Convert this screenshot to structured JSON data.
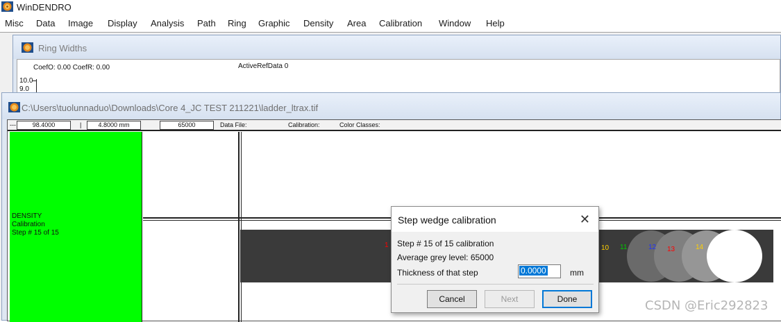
{
  "app": {
    "title": "WinDENDRO",
    "icon": "windendro-icon"
  },
  "menu": [
    "Misc",
    "Data",
    "Image",
    "Display",
    "Analysis",
    "Path",
    "Ring",
    "Graphic",
    "Density",
    "Area",
    "Calibration",
    "Window",
    "Help"
  ],
  "ring_window": {
    "title": "Ring Widths",
    "coef": "CoefO: 0.00  CoefR: 0.00",
    "active_ref": "ActiveRefData  0",
    "y_ticks": [
      "10.0",
      "9.0"
    ]
  },
  "image_window": {
    "title": "C:\\Users\\tuolunnaduo\\Downloads\\Core 4_JC TEST 211221\\ladder_ltrax.tif",
    "status": {
      "dash": "---",
      "x_value": "98.4000",
      "bar": "|",
      "y_value": "4.8000 mm",
      "grey_value": "65000",
      "data_file": "Data File:",
      "calibration": "Calibration:",
      "color_classes": "Color Classes:"
    },
    "panel": {
      "line1": "DENSITY",
      "line2": "Calibration",
      "line3": "Step # 15 of 15"
    },
    "step_labels": [
      {
        "text": "1",
        "color": "#ff0000"
      },
      {
        "text": "10",
        "color": "#ffd000"
      },
      {
        "text": "11",
        "color": "#00c800"
      },
      {
        "text": "12",
        "color": "#1e32ff"
      },
      {
        "text": "13",
        "color": "#ff0000"
      },
      {
        "text": "14",
        "color": "#ffd000"
      }
    ]
  },
  "dialog": {
    "title": "Step wedge calibration",
    "line1": "Step # 15 of 15 calibration",
    "line2": "Average grey level: 65000",
    "thickness_label": "Thickness of that step",
    "thickness_value": "0.0000",
    "unit": "mm",
    "buttons": {
      "cancel": "Cancel",
      "next": "Next",
      "done": "Done"
    }
  },
  "watermark": "CSDN @Eric292823"
}
